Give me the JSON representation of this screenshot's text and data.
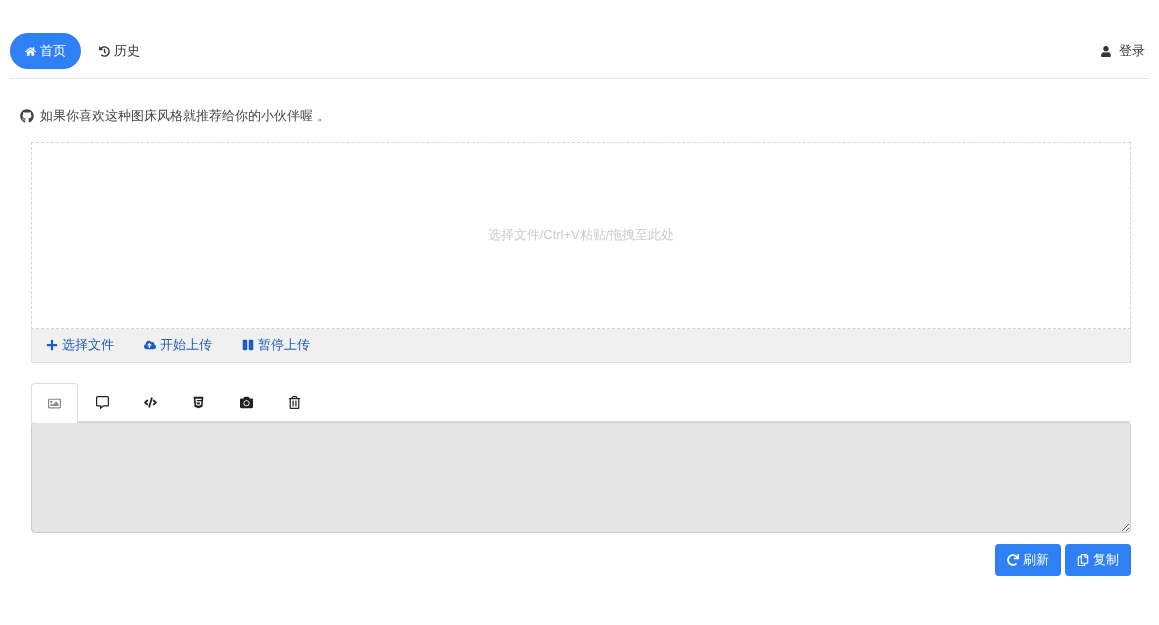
{
  "nav": {
    "items": [
      {
        "kind": "home",
        "label": "首页",
        "selected": true
      },
      {
        "kind": "history",
        "label": "历史",
        "selected": false
      }
    ],
    "login": "登录"
  },
  "notice": "如果你喜欢这种图床风格就推荐给你的小伙伴喔 。",
  "dropzone": {
    "hint": "选择文件/Ctrl+V粘贴/拖拽至此处"
  },
  "upload_actions": [
    {
      "kind": "add",
      "label": "选择文件"
    },
    {
      "kind": "upload",
      "label": "开始上传"
    },
    {
      "kind": "pause",
      "label": "暂停上传"
    }
  ],
  "output_tabs": [
    {
      "kind": "image",
      "selected": true
    },
    {
      "kind": "comment",
      "selected": false
    },
    {
      "kind": "code",
      "selected": false
    },
    {
      "kind": "html5",
      "selected": false
    },
    {
      "kind": "camera",
      "selected": false
    },
    {
      "kind": "trash",
      "selected": false
    }
  ],
  "buttons": [
    {
      "kind": "refresh",
      "label": "刷新"
    },
    {
      "kind": "copy",
      "label": "复制"
    }
  ]
}
